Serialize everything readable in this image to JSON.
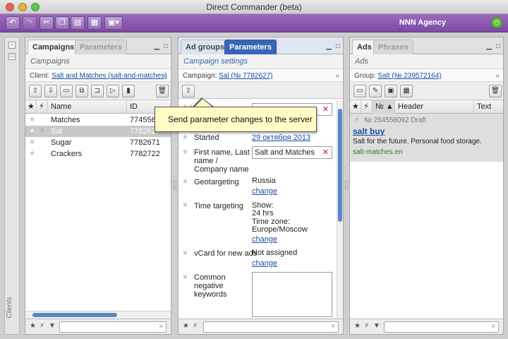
{
  "window": {
    "title": "Direct Commander (beta)"
  },
  "toolbar": {
    "agency": "NNN Agency"
  },
  "sidebar": {
    "label": "Clients"
  },
  "campaigns_panel": {
    "tabs": [
      "Campaigns",
      "Parameters"
    ],
    "subtitle": "Campaigns",
    "client_label": "Client:",
    "client_value": "Salt and Matches (salt-and-matches)",
    "columns": [
      "Name",
      "ID"
    ],
    "rows": [
      {
        "name": "Matches",
        "id": "7745567"
      },
      {
        "name": "Sal",
        "id": "7782627"
      },
      {
        "name": "Sugar",
        "id": "7782671"
      },
      {
        "name": "Crackers",
        "id": "7782722"
      }
    ]
  },
  "params_panel": {
    "tabs": [
      "Ad groups",
      "Parameters"
    ],
    "subtitle": "Campaign settings",
    "campaign_label": "Campaign:",
    "campaign_value": "Sal (№ 7782627)",
    "tooltip": "Send parameter changes to the server",
    "fields": {
      "name_label": "Name",
      "started_label": "Started",
      "started_value": "29 октября 2013",
      "fio_label": "First name, Last name / Company name",
      "fio_value": "Salt and Matches",
      "geo_label": "Geotargeting",
      "geo_value": "Russia",
      "change": "change",
      "time_label": "Time targeting",
      "time_show": "Show:",
      "time_hours": "24 hrs",
      "time_zone_label": "Time zone:",
      "time_zone_value": "Europe/Moscow",
      "vcard_label": "vCard for new ads",
      "vcard_value": "Not assigned",
      "negative_label": "Common negative keywords"
    }
  },
  "ads_panel": {
    "tabs": [
      "Ads",
      "Phrases"
    ],
    "subtitle": "Ads",
    "group_label": "Group:",
    "group_value": "Salt (№ 239572164)",
    "columns": [
      "№",
      "Header",
      "Text"
    ],
    "ad": {
      "meta": "№ 254558092  Draft",
      "title": "salt buy",
      "text": "Salt for the future. Personal food storage.",
      "url": "salt-matches.en"
    }
  }
}
